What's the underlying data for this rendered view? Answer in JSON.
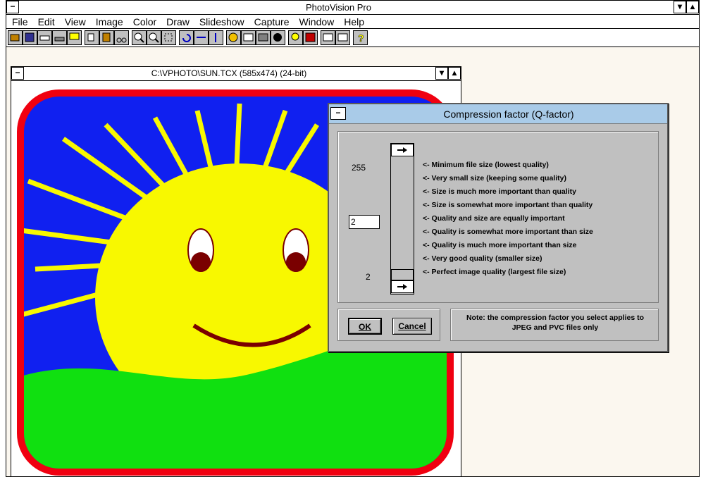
{
  "app": {
    "title": "PhotoVision Pro",
    "sys_menu": "−",
    "min_glyph": "▾",
    "max_glyph": "▴"
  },
  "menu": [
    "File",
    "Edit",
    "View",
    "Image",
    "Color",
    "Draw",
    "Slideshow",
    "Capture",
    "Window",
    "Help"
  ],
  "toolbar": {
    "icons": [
      "open-icon",
      "save-icon",
      "print-icon",
      "scanner-icon",
      "monitor-icon",
      "copy-icon",
      "paste-icon",
      "cut-icon",
      "zoom-in-icon",
      "zoom-out-icon",
      "crop-icon",
      "rotate-icon",
      "flip-horizontal-icon",
      "flip-vertical-icon",
      "palette-icon",
      "brightness-icon",
      "contrast-icon",
      "invert-icon",
      "lamp-icon",
      "image-icon",
      "slideshow-icon",
      "capture-icon",
      "help-icon"
    ]
  },
  "child_window": {
    "title": "C:\\VPHOTO\\SUN.TCX (585x474) (24-bit)",
    "sys_menu": "−"
  },
  "dialog": {
    "title": "Compression factor (Q-factor)",
    "sys_menu": "−",
    "top_value": "255",
    "bottom_value": "2",
    "input_value": "2",
    "slider_level": 0.0,
    "options": [
      "<- Minimum file size (lowest quality)",
      "<- Very small size (keeping some quality)",
      "<- Size is much more important than quality",
      "<- Size is somewhat more important than quality",
      "<- Quality and size are equally important",
      "<- Quality is somewhat more important than size",
      "<- Quality is much more important than size",
      "<- Very good quality (smaller size)",
      "<- Perfect image quality (largest file size)"
    ],
    "ok_label": "OK",
    "cancel_label": "Cancel",
    "note": "Note: the compression factor you select applies to JPEG and PVC files only"
  },
  "colors": {
    "sky": "#1020f0",
    "sun": "#f8f800",
    "grass": "#10e010",
    "border": "#f00010",
    "eye": "#7a0000",
    "dialog_title": "#a9cbe8"
  }
}
